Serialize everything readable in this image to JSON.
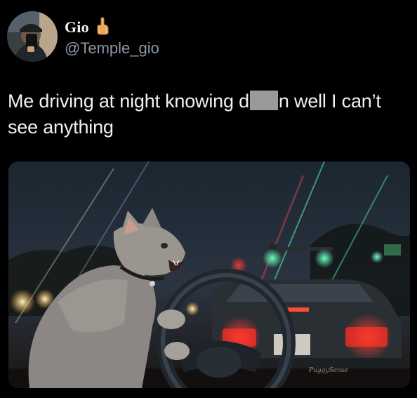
{
  "author": {
    "display_name": "Gio",
    "badge_icon": "hand-point-up-emoji",
    "handle": "@Temple_gio"
  },
  "tweet": {
    "text_before_redaction": "Me driving at night knowing d",
    "text_after_redaction": "n well I can’t see anything"
  },
  "media": {
    "description_icon": "cat-driving-at-night-image",
    "watermark": "PuggySense"
  },
  "colors": {
    "background": "#000000",
    "handle": "#8b98a5",
    "text": "#eef0f1"
  }
}
